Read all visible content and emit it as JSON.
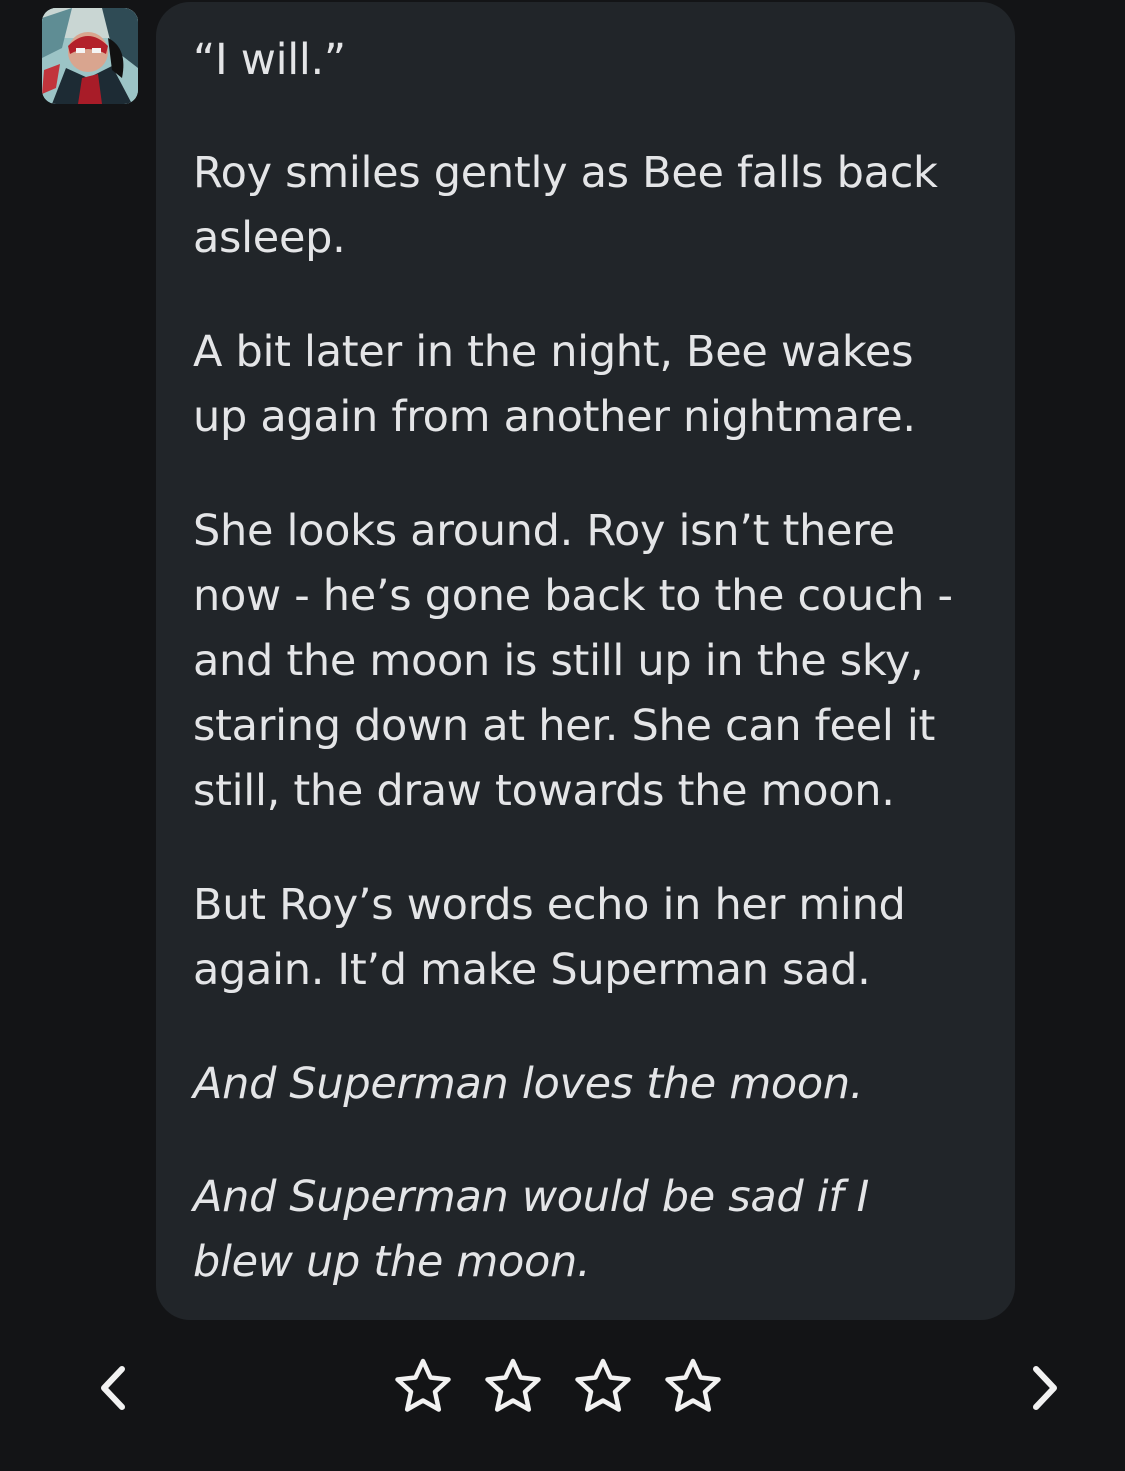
{
  "message": {
    "paragraphs": [
      {
        "text": "“I will.”",
        "italic": false
      },
      {
        "text": "Roy smiles gently as Bee falls back asleep.",
        "italic": false
      },
      {
        "text": "A bit later in the night, Bee wakes up again from another nightmare.",
        "italic": false
      },
      {
        "text": "She looks around. Roy isn’t there now - he’s gone back to the couch - and the moon is still up in the sky, staring down at her. She can feel it still, the draw towards the moon.",
        "italic": false
      },
      {
        "text": "But Roy’s words echo in her mind again. It’d make Superman sad.",
        "italic": false
      },
      {
        "text": "And Superman loves the moon.",
        "italic": true
      },
      {
        "text": "And Superman would be sad if I blew up the moon.",
        "italic": true
      }
    ]
  },
  "rating": {
    "max_stars": 4,
    "selected": 0,
    "icon": "star-outline-icon"
  },
  "navigation": {
    "prev_icon": "chevron-left-icon",
    "next_icon": "chevron-right-icon"
  },
  "colors": {
    "background": "#131416",
    "bubble": "#212529",
    "text": "#e4e5e7",
    "icon": "#f2f2f2"
  }
}
